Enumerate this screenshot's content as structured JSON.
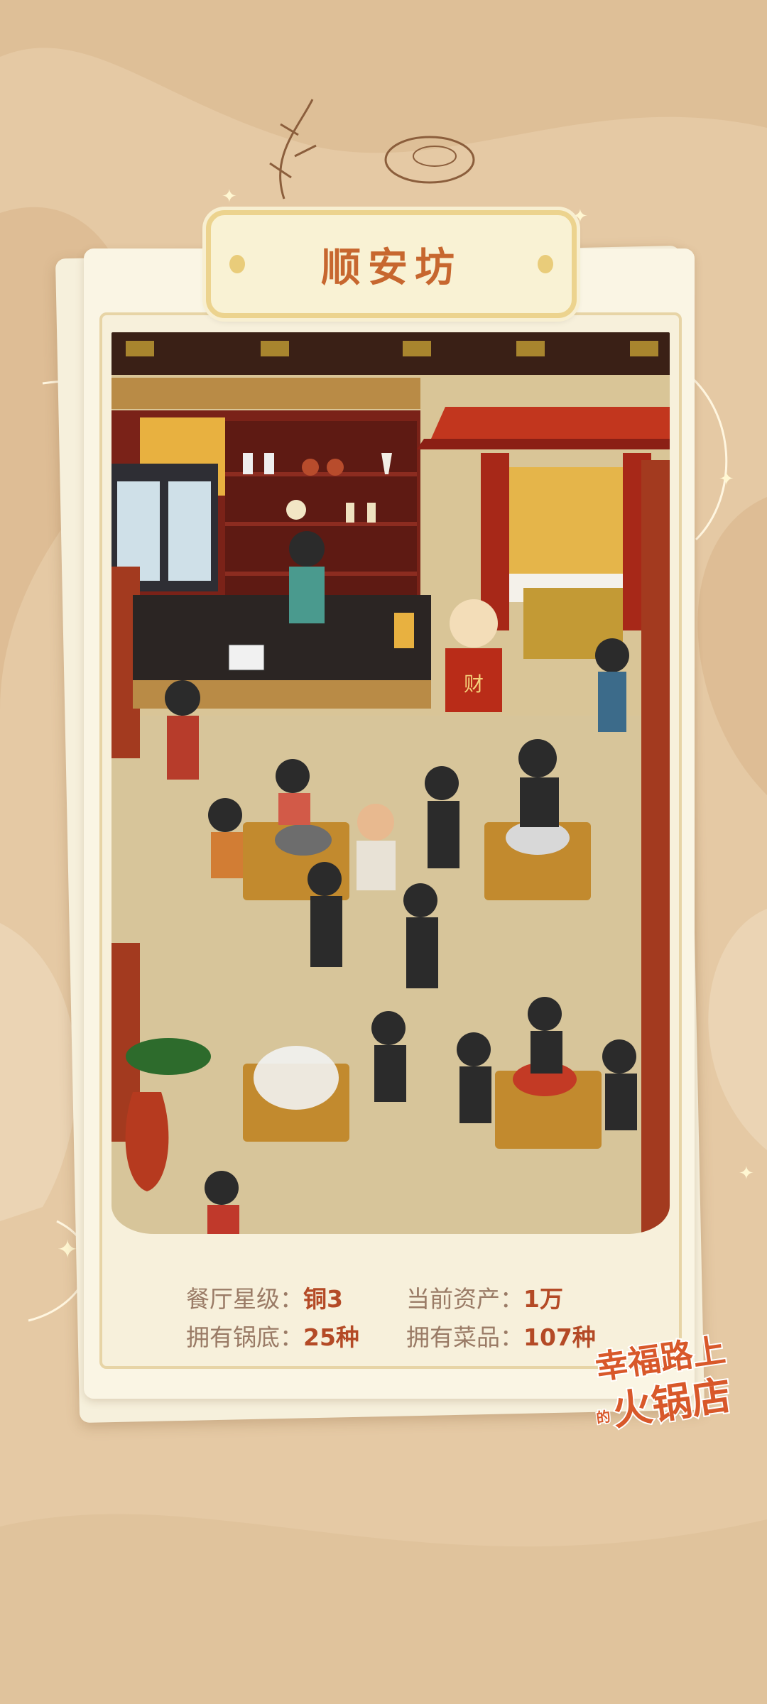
{
  "restaurant": {
    "name": "顺安坊"
  },
  "stats": [
    {
      "label": "餐厅星级：",
      "value": "铜3"
    },
    {
      "label": "当前资产：",
      "value": "1万"
    },
    {
      "label": "拥有锅底：",
      "value": "25种"
    },
    {
      "label": "拥有菜品：",
      "value": "107种"
    }
  ],
  "scene": {
    "sign_text": "财"
  },
  "logo": {
    "title": "幸福路上的火锅店"
  },
  "colors": {
    "background": "#e5c9a4",
    "card": "#faf5e4",
    "title": "#c7672f",
    "stat_value": "#b44a26",
    "stat_label": "#9a7b66"
  }
}
